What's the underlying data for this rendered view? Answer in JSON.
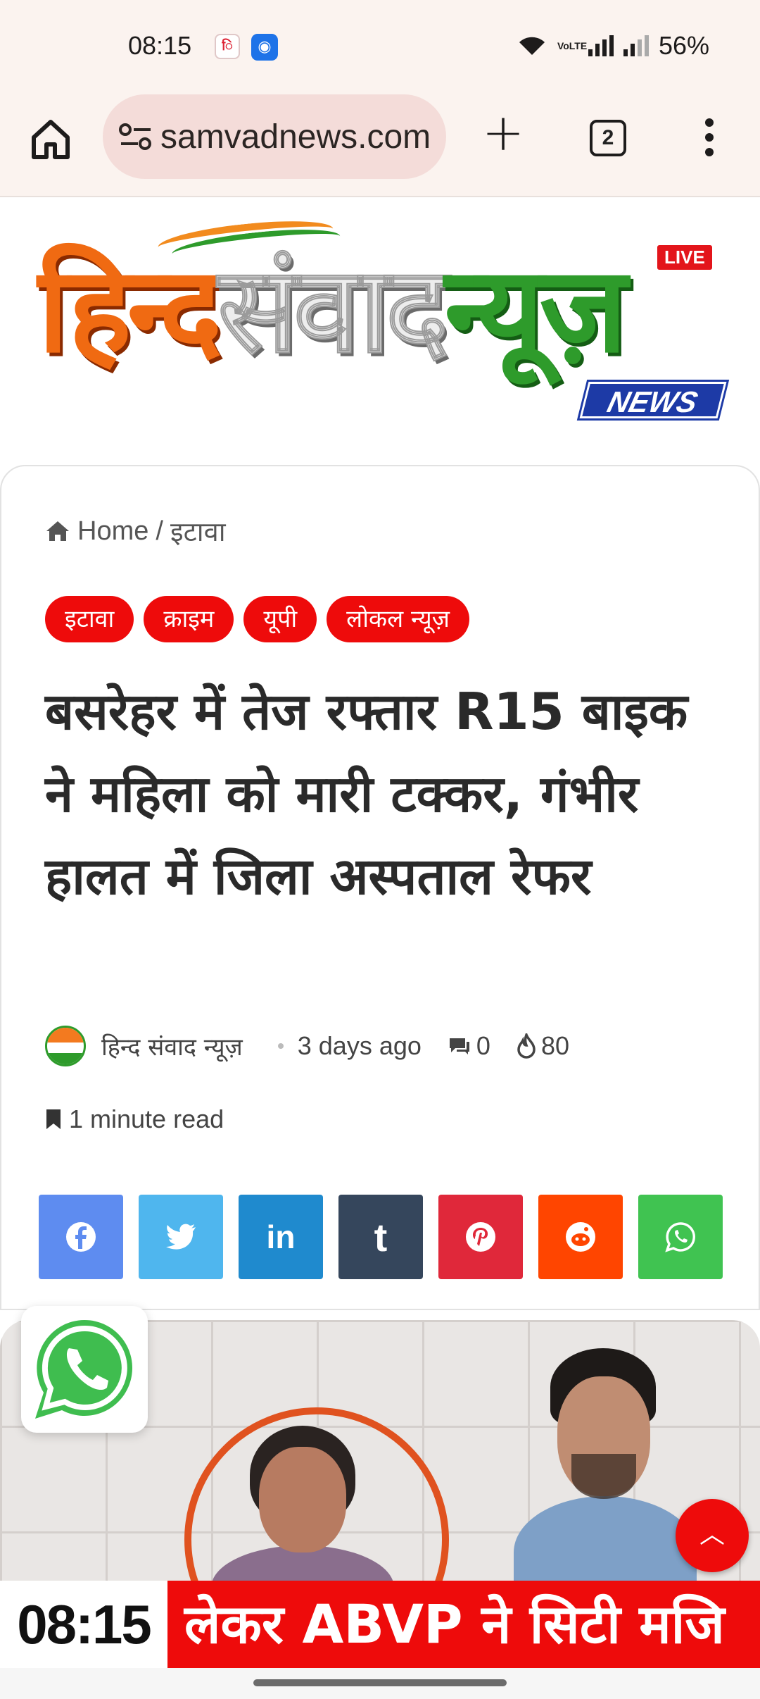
{
  "status_bar": {
    "time": "08:15",
    "volte": "VoLTE",
    "battery": "56%"
  },
  "browser": {
    "url": "samvadnews.com",
    "tab_count": "2"
  },
  "logo": {
    "part1": "हिन्द",
    "part2": "संवाद",
    "part3": "न्यूज़",
    "live_badge": "LIVE",
    "news_badge": "NEWS"
  },
  "breadcrumb": {
    "home": "Home",
    "separator": "/",
    "current": "इटावा"
  },
  "tags": [
    "इटावा",
    "क्राइम",
    "यूपी",
    "लोकल न्यूज़"
  ],
  "article": {
    "headline": "बसरेहर में तेज रफ्तार R15 बाइक ने महिला को मारी टक्कर, गंभीर हालत में जिला अस्पताल रेफर",
    "author": "हिन्द संवाद न्यूज़",
    "posted": "3 days ago",
    "comments": "0",
    "views": "80",
    "read_time": "1 minute read"
  },
  "share_buttons": [
    {
      "name": "facebook",
      "color": "#5e8cf0",
      "glyph": "f"
    },
    {
      "name": "twitter",
      "color": "#4fb6ee",
      "glyph": "t"
    },
    {
      "name": "linkedin",
      "color": "#1f8ace",
      "glyph": "in"
    },
    {
      "name": "tumblr",
      "color": "#35465c",
      "glyph": "t"
    },
    {
      "name": "pinterest",
      "color": "#e0283a",
      "glyph": "p"
    },
    {
      "name": "reddit",
      "color": "#ff4500",
      "glyph": "r"
    },
    {
      "name": "whatsapp",
      "color": "#40c351",
      "glyph": "w"
    }
  ],
  "ticker": {
    "time": "08:15",
    "text": "लेकर ABVP ने सिटी मजि"
  },
  "colors": {
    "accent_red": "#ee0b0b",
    "browser_bg": "#fbf3ef",
    "url_pill": "#f4dcd9"
  }
}
